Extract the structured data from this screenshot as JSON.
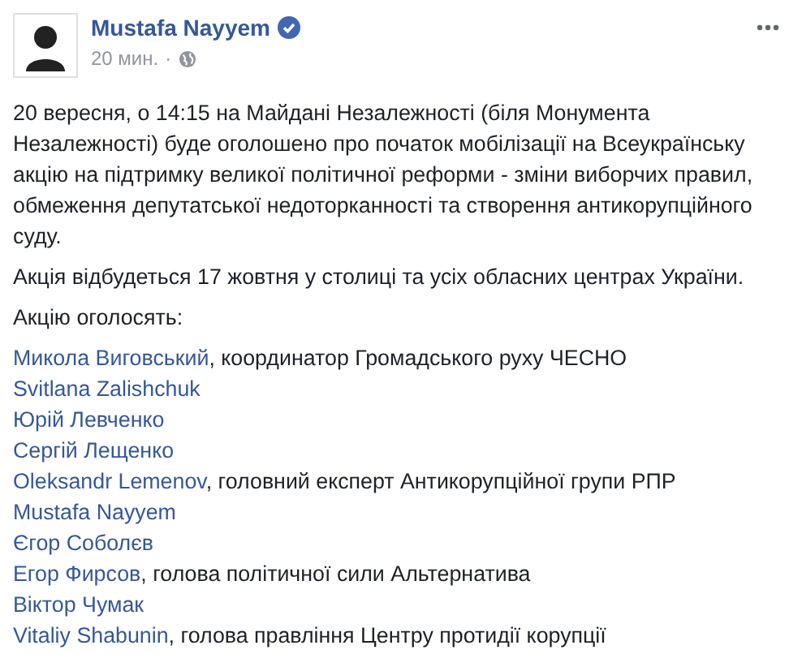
{
  "author": {
    "name": "Mustafa Nayyem",
    "verified": true,
    "time": "20 мин.",
    "separator": "·"
  },
  "paragraphs": [
    "20 вересня, о 14:15 на Майдані Незалежності (біля Монумента Незалежності) буде оголошено про початок мобілізації на Всеукраїнську акцію на підтримку великої політичної реформи - зміни виборчих правил, обмеження депутатської недоторканності та створення антикорупційного суду.",
    "Акція відбудеться 17 жовтня у столиці та усіх обласних центрах України.",
    "Акцію оголосять:"
  ],
  "announcers": [
    {
      "name": "Микола Виговський",
      "role": ", координатор Громадського руху ЧЕСНО"
    },
    {
      "name": "Svitlana Zalishchuk"
    },
    {
      "name": "Юрій Левченко"
    },
    {
      "name": "Сергій Лещенко"
    },
    {
      "name": "Oleksandr Lemenov",
      "role": ", головний експерт Антикорупційної групи РПР"
    },
    {
      "name": "Mustafa Nayyem"
    },
    {
      "name": "Єгор Соболєв"
    },
    {
      "name": "Егор Фирсов",
      "role": ", голова політичної сили Альтернатива"
    },
    {
      "name": "Віктор Чумак"
    },
    {
      "name": "Vitaliy Shabunin",
      "role": ", голова правління Центру протидії корупції"
    }
  ]
}
